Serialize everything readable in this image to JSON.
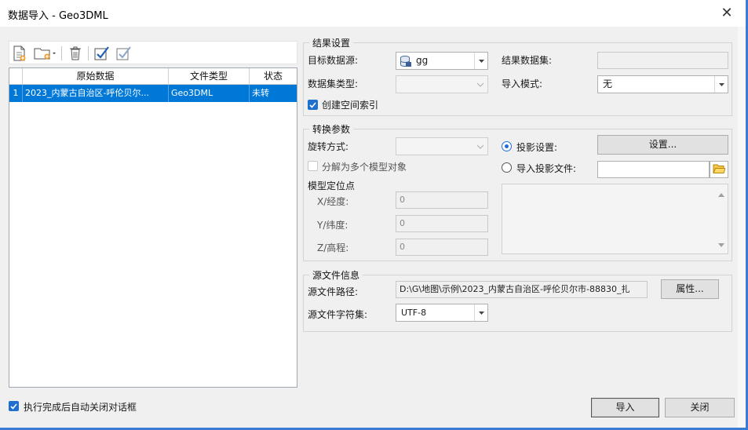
{
  "window": {
    "title": "数据导入 - Geo3DML",
    "close_glyph": "✕"
  },
  "toolbar": {
    "icons": [
      "add-file-icon",
      "add-folder-icon",
      "delete-icon",
      "select-all-icon",
      "invert-select-icon"
    ]
  },
  "list": {
    "columns": [
      "原始数据",
      "文件类型",
      "状态"
    ],
    "rows": [
      {
        "index": "1",
        "source": "2023_内蒙古自治区-呼伦贝尔...",
        "type": "Geo3DML",
        "status": "未转"
      }
    ]
  },
  "result_settings": {
    "title": "结果设置",
    "target_datasource_label": "目标数据源:",
    "target_datasource_value": "gg",
    "result_dataset_label": "结果数据集:",
    "result_dataset_value": "",
    "dataset_type_label": "数据集类型:",
    "dataset_type_value": "",
    "import_mode_label": "导入模式:",
    "import_mode_value": "无",
    "spatial_index_label": "创建空间索引",
    "spatial_index_checked": true
  },
  "convert_params": {
    "title": "转换参数",
    "rotation_label": "旋转方式:",
    "rotation_value": "",
    "split_label": "分解为多个模型对象",
    "split_checked": false,
    "locate_label": "模型定位点",
    "x_label": "X/经度:",
    "x_value": "0",
    "y_label": "Y/纬度:",
    "y_value": "0",
    "z_label": "Z/高程:",
    "z_value": "0",
    "projection_setting_label": "投影设置:",
    "projection_setting_selected": true,
    "projection_setting_button": "设置...",
    "import_projection_label": "导入投影文件:",
    "import_projection_selected": false,
    "import_projection_value": ""
  },
  "source_info": {
    "title": "源文件信息",
    "path_label": "源文件路径:",
    "path_value": "D:\\G\\地图\\示例\\2023_内蒙古自治区-呼伦贝尔市-88830_扎",
    "properties_button": "属性...",
    "charset_label": "源文件字符集:",
    "charset_value": "UTF-8"
  },
  "footer": {
    "auto_close_label": "执行完成后自动关闭对话框",
    "auto_close_checked": true,
    "import_button": "导入",
    "close_button": "关闭"
  },
  "colors": {
    "accent": "#0078d7",
    "check": "#1f6fd1",
    "window_border": "#3a7bd5"
  }
}
